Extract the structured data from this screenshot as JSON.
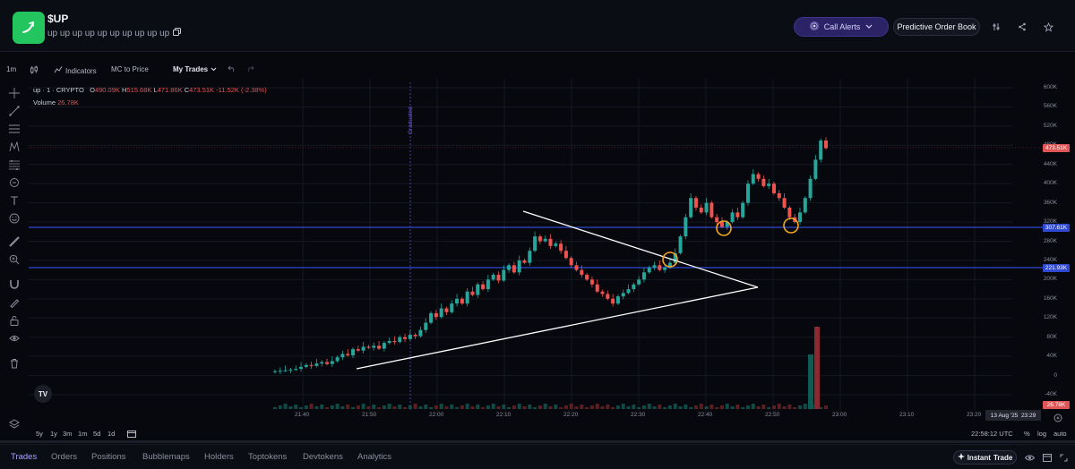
{
  "header": {
    "token_name": "$UP",
    "token_subtitle": "up up up up up up up up up up",
    "call_alerts_label": "Call Alerts",
    "predictive_order_book_label": "Predictive Order Book"
  },
  "toolbar": {
    "interval": "1m",
    "indicators_label": "Indicators",
    "mc_to_price_label": "MC to Price",
    "my_trades_label": "My Trades"
  },
  "legend": {
    "symbol": "up · 1 · CRYPTO",
    "o_label": "O",
    "o_value": "490.09K",
    "h_label": "H",
    "h_value": "515.68K",
    "l_label": "L",
    "l_value": "471.86K",
    "c_label": "C",
    "c_value": "473.51K",
    "change": "-11.52K (-2.38%)",
    "volume_label": "Volume",
    "volume_value": "26.78K"
  },
  "chart_data": {
    "type": "candlestick",
    "event_label": "Graduated",
    "y_ticks": [
      "600K",
      "560K",
      "520K",
      "480K",
      "440K",
      "400K",
      "360K",
      "320K",
      "280K",
      "240K",
      "200K",
      "160K",
      "120K",
      "80K",
      "40K",
      "0",
      "-40K"
    ],
    "x_ticks": [
      "21:40",
      "21:50",
      "22:00",
      "22:10",
      "22:20",
      "22:30",
      "22:40",
      "22:50",
      "23:00",
      "23:10",
      "23:20"
    ],
    "price_tags": {
      "last": "473.51K",
      "level_upper": "307.61K",
      "level_lower": "221.93K",
      "volume": "26.78K"
    },
    "date_label": "13 Aug '25",
    "time_label": "23:29",
    "colors": {
      "up": "#26a69a",
      "down": "#ef5350",
      "level": "#2f49d1",
      "marker": "#f5a623"
    }
  },
  "range": {
    "buttons": [
      "5y",
      "1y",
      "3m",
      "1m",
      "5d",
      "1d"
    ],
    "clock": "22:58:12 UTC",
    "pct_label": "%",
    "log_label": "log",
    "auto_label": "auto"
  },
  "tabs": [
    {
      "label": "Trades"
    },
    {
      "label": "Orders"
    },
    {
      "label": "Positions"
    },
    {
      "label": "Bubblemaps"
    },
    {
      "label": "Holders"
    },
    {
      "label": "Toptokens"
    },
    {
      "label": "Devtokens"
    },
    {
      "label": "Analytics"
    }
  ],
  "instant_trade": {
    "pre": "Instant ",
    "label": "Trade"
  }
}
